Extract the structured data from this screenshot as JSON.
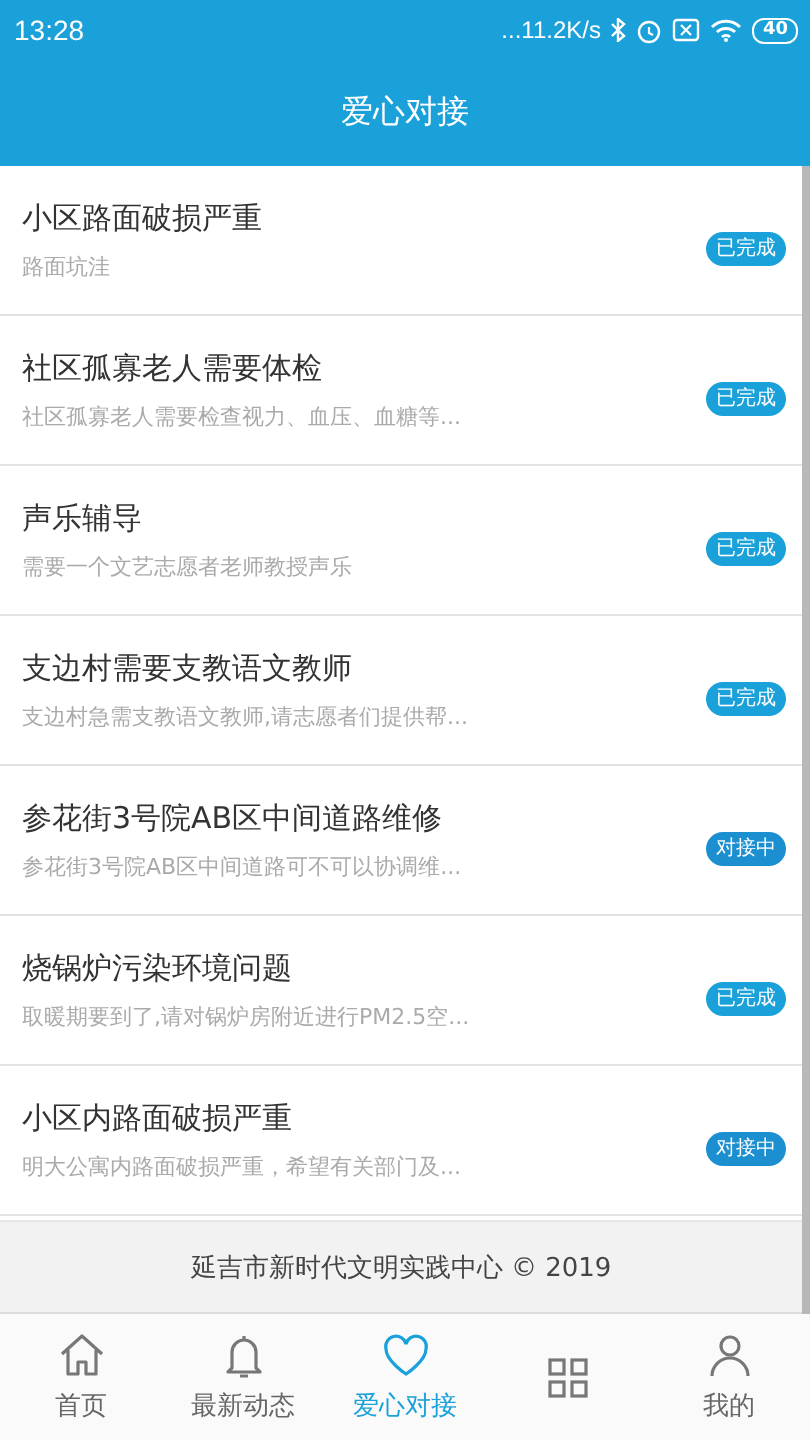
{
  "status_bar": {
    "time": "13:28",
    "network_speed": "...11.2K/s",
    "battery": "40"
  },
  "header": {
    "title": "爱心对接"
  },
  "items": [
    {
      "title": "小区路面破损严重",
      "summary": "路面坑洼",
      "status": "已完成",
      "kind": "done"
    },
    {
      "title": "社区孤寡老人需要体检",
      "summary": "社区孤寡老人需要检查视力、血压、血糖等...",
      "status": "已完成",
      "kind": "done"
    },
    {
      "title": "声乐辅导",
      "summary": "需要一个文艺志愿者老师教授声乐",
      "status": "已完成",
      "kind": "done"
    },
    {
      "title": "支边村需要支教语文教师",
      "summary": "支边村急需支教语文教师,请志愿者们提供帮...",
      "status": "已完成",
      "kind": "done"
    },
    {
      "title": "参花街3号院AB区中间道路维修",
      "summary": "参花街3号院AB区中间道路可不可以协调维...",
      "status": "对接中",
      "kind": "ongoing"
    },
    {
      "title": "烧锅炉污染环境问题",
      "summary": "取暖期要到了,请对锅炉房附近进行PM2.5空...",
      "status": "已完成",
      "kind": "done"
    },
    {
      "title": "小区内路面破损严重",
      "summary": "明大公寓内路面破损严重，希望有关部门及...",
      "status": "对接中",
      "kind": "ongoing"
    }
  ],
  "footer": {
    "text": "延吉市新时代文明实践中心 © 2019"
  },
  "tab_bar": [
    {
      "kind": "home",
      "label": "首页",
      "selected": false
    },
    {
      "kind": "bell",
      "label": "最新动态",
      "selected": false
    },
    {
      "kind": "heart",
      "label": "爱心对接",
      "selected": true
    },
    {
      "kind": "grid",
      "selected": false
    },
    {
      "kind": "person",
      "label": "我的",
      "selected": false
    }
  ]
}
